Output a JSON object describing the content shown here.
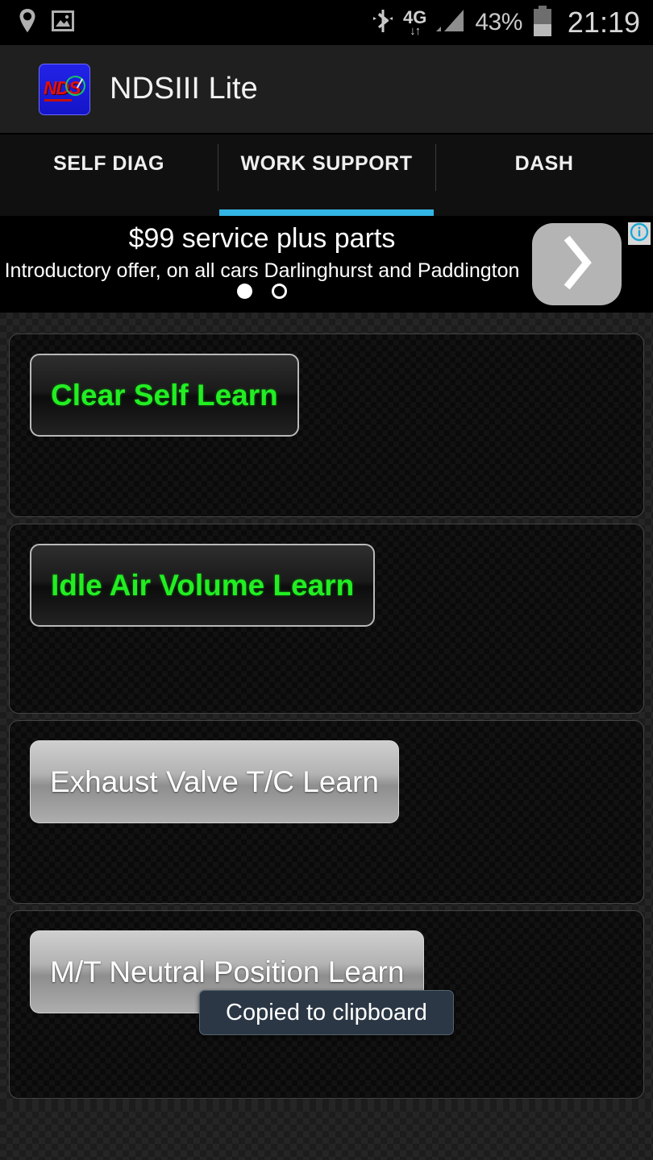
{
  "statusbar": {
    "left_icons": [
      "location-pin-icon",
      "image-icon"
    ],
    "bluetooth_icon": "bluetooth-icon",
    "network_label": "4G",
    "network_arrows": "↓↑",
    "signal_icon": "signal-bars-icon",
    "battery_percent": "43%",
    "battery_icon": "battery-icon",
    "time": "21:19"
  },
  "actionbar": {
    "logo_text": "NDS",
    "logo_name": "app-logo-icon",
    "title": "NDSIII Lite"
  },
  "tabs": [
    {
      "label": "SELF DIAG",
      "active": false
    },
    {
      "label": "WORK SUPPORT",
      "active": true
    },
    {
      "label": "DASH",
      "active": false
    }
  ],
  "ad": {
    "headline": "$99 service plus parts",
    "subline": "Introductory offer, on all cars Darlinghurst and Paddington",
    "arrow_icon": "chevron-right-icon",
    "info_icon": "info-icon",
    "info_label": "i",
    "dots": [
      {
        "state": "filled"
      },
      {
        "state": "hollow"
      }
    ]
  },
  "panels": [
    {
      "button_label": "Clear Self Learn",
      "style": "dark"
    },
    {
      "button_label": "Idle Air Volume Learn",
      "style": "dark"
    },
    {
      "button_label": "Exhaust Valve T/C Learn",
      "style": "light"
    },
    {
      "button_label": "M/T Neutral Position Learn",
      "style": "light"
    }
  ],
  "toast": {
    "message": "Copied to clipboard"
  },
  "colors": {
    "accent_tab": "#33b5e5",
    "button_green_text": "#22ee22",
    "logo_blue": "#1f1fdc",
    "logo_red": "#e01010",
    "toast_bg": "#2b3744"
  }
}
